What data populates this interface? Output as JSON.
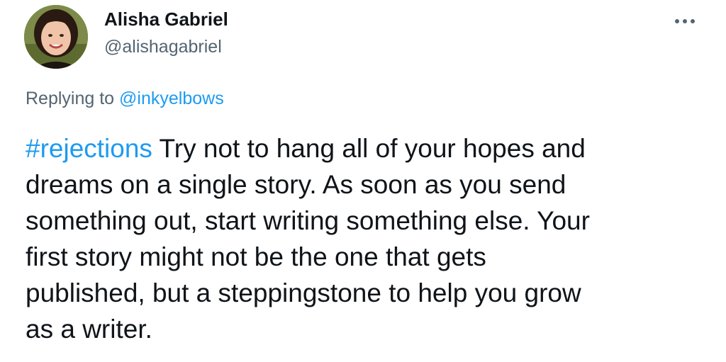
{
  "tweet": {
    "author": {
      "name": "Alisha Gabriel",
      "handle": "@alishagabriel"
    },
    "more_icon": "more-dots-icon",
    "reply_context": {
      "prefix": "Replying to",
      "mention": "@inkyelbows"
    },
    "text": {
      "hashtag": "#rejections",
      "lines": [
        " Try not to hang all of your hopes and",
        "dreams on a single story. As soon as you send",
        "something out, start writing something else. Your",
        "first story might not be the one that gets",
        "published, but a steppingstone to help you grow",
        "as a writer."
      ]
    }
  },
  "colors": {
    "link": "#1d9bf0",
    "secondary_text": "#536471",
    "primary_text": "#0f1419"
  }
}
